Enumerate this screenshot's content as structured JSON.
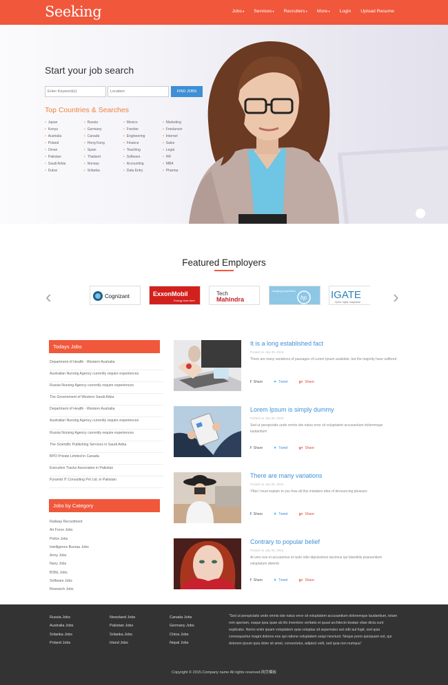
{
  "header": {
    "logo": "Seeking",
    "nav": [
      "Jobs",
      "Services",
      "Recruiters",
      "More",
      "Login",
      "Upload Resume"
    ]
  },
  "hero": {
    "title": "Start your job search",
    "keyword_placeholder": "Enter Keyword(s)",
    "location_placeholder": "Location",
    "find_button": "FIND JOBS",
    "countries_title": "Top Countries & Searches",
    "columns": [
      [
        "Japan",
        "Kenya",
        "Australia",
        "Poland",
        "Oman",
        "Pakistan",
        "Saudi Arbia",
        "Dubai"
      ],
      [
        "Russia",
        "Germany",
        "Canada",
        "Hong Kong",
        "Spain",
        "Thailand",
        "Norway",
        "Srilanka"
      ],
      [
        "Mexico",
        "Fresher",
        "Engineering",
        "Finance",
        "Teaching",
        "Software",
        "Accounting",
        "Data Entry"
      ],
      [
        "Marketing",
        "Freelancer",
        "Internet",
        "Sales",
        "Legal",
        "HR",
        "MBA",
        "Pharma"
      ]
    ]
  },
  "featured": {
    "title": "Featured Employers",
    "logos": [
      "Cognizant",
      "ExxonMobil",
      "Tech Mahindra",
      "hp",
      "IGATE"
    ],
    "exxon_tagline": "Energy lives here",
    "tech_word": "Tech",
    "mahindra_word": "Mahindra",
    "hp_tagline": "changing perspectives",
    "igate_tagline": "Speed. Agility. Imagination"
  },
  "sidebar": {
    "today_title": "Todays Jobs",
    "today_jobs": [
      "Department of Health - Western Australia",
      "Australian Nursing Agency currently require experiences",
      "Russia Nursing Agency currently require experiences",
      "The Government of Western Saudi Arbia",
      "Department of Health - Western Australia",
      "Australian Nursing Agency currently require experiences",
      "Russia Nursing Agency currently require experiences",
      "The Scientific Publishing Services in Saudi Arbia",
      "BPO Private Limited in Canada",
      "Executive Tracks Associates in Pakistan",
      "Pyramid IT Consulting Pvt Ltd. in Pakistan"
    ],
    "category_title": "Jobs by Category",
    "categories": [
      "Railway Recruitment",
      "Air Force Jobs",
      "Police Jobs",
      "Intelligence Bureau Jobs",
      "Army Jobs",
      "Navy Jobs",
      "BSNL Jobs",
      "Software Jobs",
      "Research Jobs"
    ]
  },
  "posts": [
    {
      "title": "It is a long established fact",
      "meta": "Posted on July 05, 2015",
      "text": "There are many variations of passages of Lorem Ipsum available, but the majority have suffered"
    },
    {
      "title": "Lorem Ipsum is simply dummy",
      "meta": "Posted on July 05, 2015",
      "text": "Sed ut perspiciatis unde omnis iste natus error sit voluptatem accusantium doloremque laudantium"
    },
    {
      "title": "There are many variations",
      "meta": "Posted on July 05, 2015",
      "text": "YBut I must explain to you how all this mistaken idea of denouncing pleasure"
    },
    {
      "title": "Contrary to popular belief",
      "meta": "Posted on July 05, 2015",
      "text": "At vero eos et accusamus et iusto odio dignissimos ducimus qui blanditiis praesentium voluptatum deleniti"
    }
  ],
  "share": {
    "share": "Share",
    "tweet": "Tweet",
    "gplus": "Share"
  },
  "footer": {
    "col1": [
      "Russia Jobs",
      "Australia Jobs",
      "Srilanka Jobs",
      "Poland Jobs"
    ],
    "col2": [
      "Newzland Jobs",
      "Pakistan Jobs",
      "Srilanka Jobs",
      "Irland Jobs"
    ],
    "col3": [
      "Canada Jobs",
      "Germany Jobs",
      "China Jobs",
      "Nepal Jobs"
    ],
    "quote": "\"Sed ut perspiciatis unde omnis iste natus error sit voluptatem accusantium doloremque laudantium, totam rem aperiam, eaque ipsa quae ab illo inventore veritatis et quasi architecto beatae vitae dicta sunt explicabo. Nemo enim ipsam voluptatem quia voluptas sit aspernatur aut odit aut fugit, sed quia consequuntur magni dolores eos qui ratione voluptatem sequi nesciunt. Neque porro quisquam est, qui dolorem ipsum quia dolor sit amet, consectetur, adipisci velit, sed quia non numqua\"",
    "copyright": "Copyright © 2015.Company name All rights reserved.网页模板"
  },
  "colors": {
    "brand": "#f0573b",
    "link": "#3d8fd6",
    "accent": "#f0803b",
    "footer": "#333333"
  }
}
